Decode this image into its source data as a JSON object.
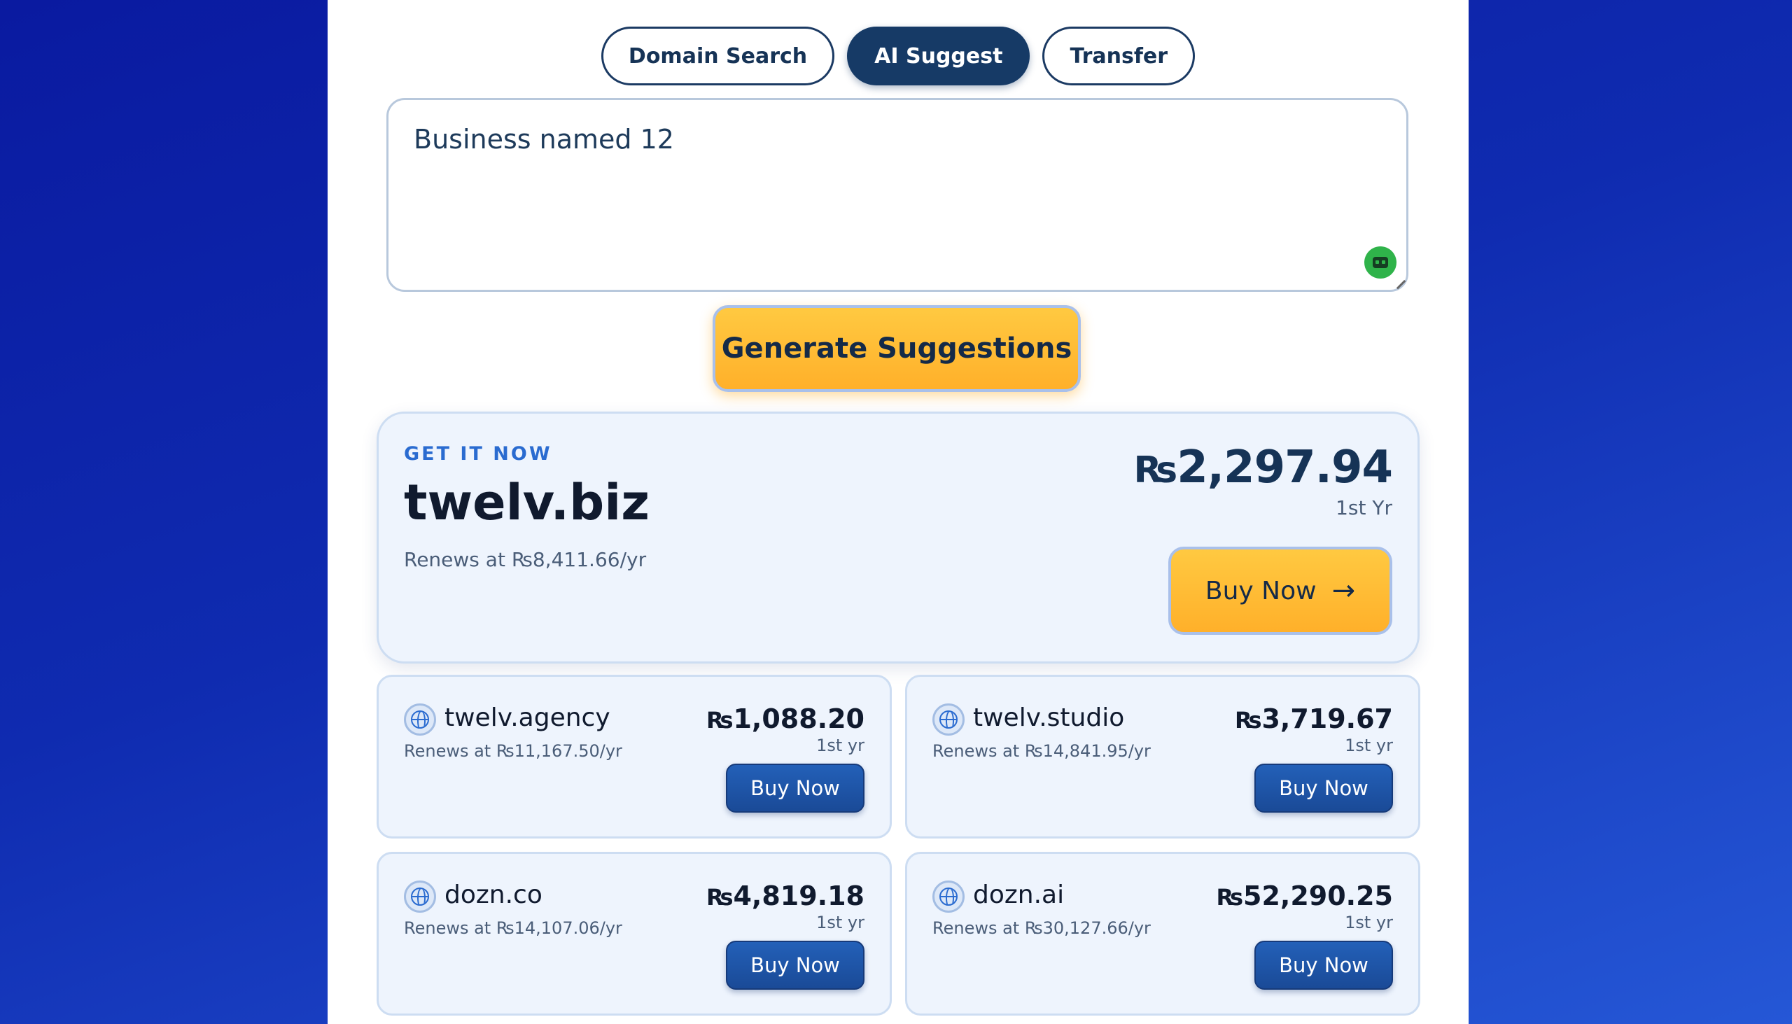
{
  "tabs": [
    {
      "label": "Domain Search",
      "active": false
    },
    {
      "label": "AI Suggest",
      "active": true
    },
    {
      "label": "Transfer",
      "active": false
    }
  ],
  "prompt": {
    "value": "Business named 12"
  },
  "generate_label": "Generate Suggestions",
  "featured": {
    "tag": "GET IT NOW",
    "domain": "twelv.biz",
    "renew": "Renews at ₨8,411.66/yr",
    "currency": "₨",
    "price": "2,297.94",
    "period": "1st Yr",
    "buy_label": "Buy Now",
    "arrow": "→"
  },
  "cards": [
    {
      "domain": "twelv.agency",
      "renew": "Renews at ₨11,167.50/yr",
      "currency": "₨",
      "price": "1,088.20",
      "period": "1st yr",
      "buy_label": "Buy Now"
    },
    {
      "domain": "twelv.studio",
      "renew": "Renews at ₨14,841.95/yr",
      "currency": "₨",
      "price": "3,719.67",
      "period": "1st yr",
      "buy_label": "Buy Now"
    },
    {
      "domain": "dozn.co",
      "renew": "Renews at ₨14,107.06/yr",
      "currency": "₨",
      "price": "4,819.18",
      "period": "1st yr",
      "buy_label": "Buy Now"
    },
    {
      "domain": "dozn.ai",
      "renew": "Renews at ₨30,127.66/yr",
      "currency": "₨",
      "price": "52,290.25",
      "period": "1st yr",
      "buy_label": "Buy Now"
    }
  ],
  "colors": {
    "accent": "#ffb02a",
    "primary": "#163a66",
    "link": "#2a6bd0"
  }
}
